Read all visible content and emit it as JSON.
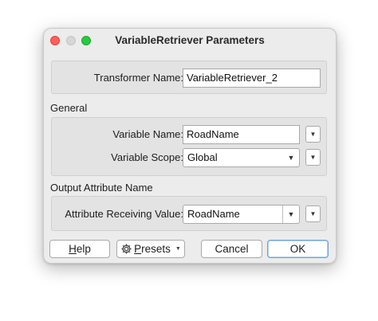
{
  "window": {
    "title": "VariableRetriever Parameters"
  },
  "transformer": {
    "label": "Transformer Name:",
    "value": "VariableRetriever_2"
  },
  "general": {
    "section_label": "General",
    "variable_name": {
      "label": "Variable Name:",
      "value": "RoadName"
    },
    "variable_scope": {
      "label": "Variable Scope:",
      "value": "Global"
    }
  },
  "output": {
    "section_label": "Output Attribute Name",
    "receiving": {
      "label": "Attribute Receiving Value:",
      "value": "RoadName"
    }
  },
  "buttons": {
    "help_first": "H",
    "help_rest": "elp",
    "presets_first": "P",
    "presets_rest": "resets",
    "cancel": "Cancel",
    "ok": "OK"
  }
}
